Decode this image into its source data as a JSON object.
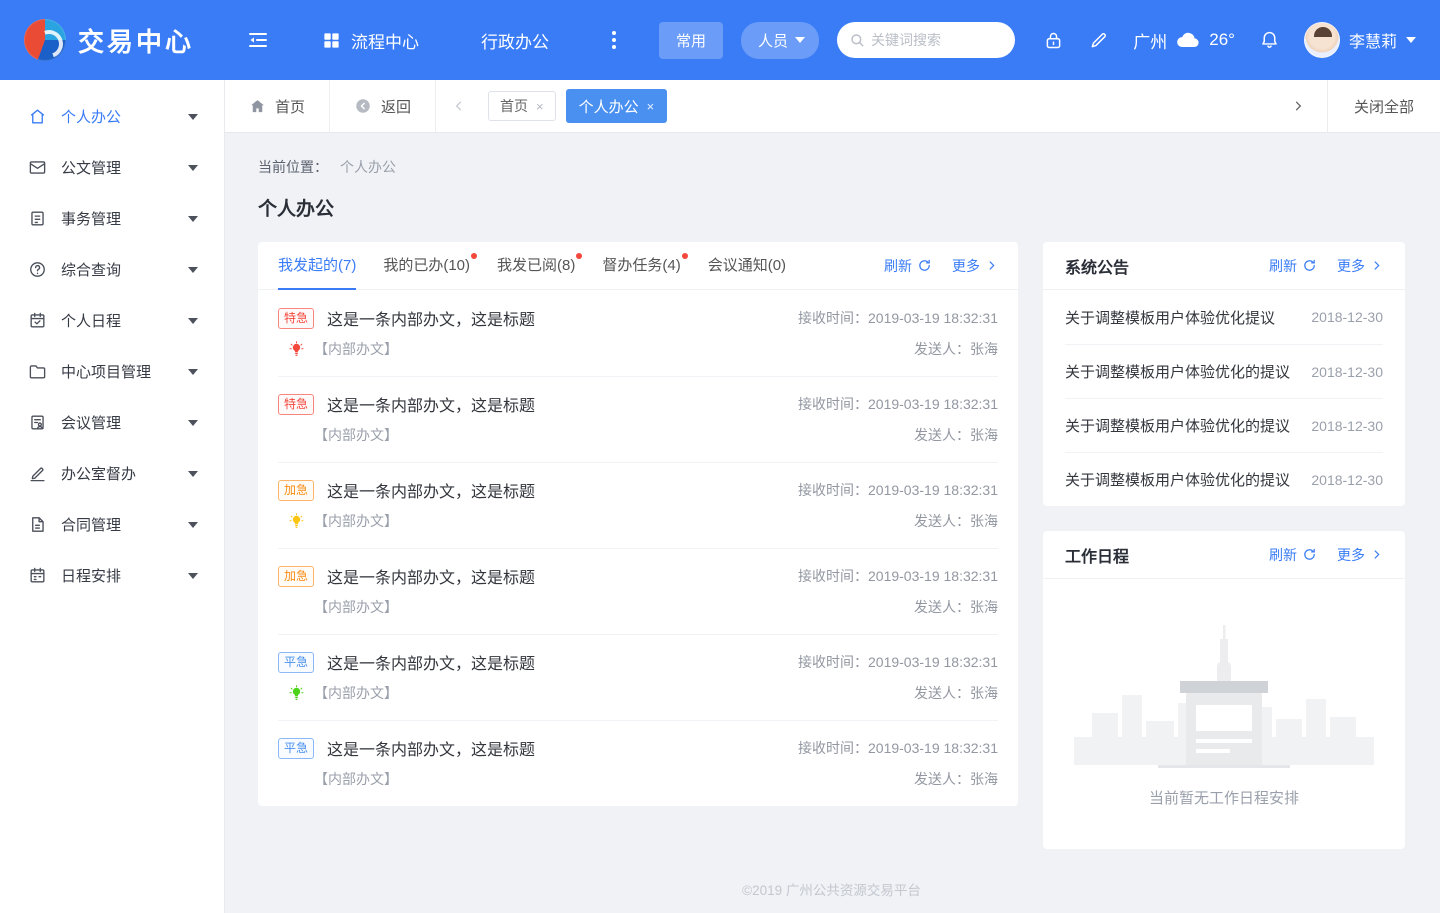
{
  "colors": {
    "primary": "#3a7cf6",
    "chip": "#4a90f0",
    "urgent": "#f5483d",
    "rush": "#fa8c16",
    "normal": "#4a90f0",
    "yellow": "#fbc514",
    "green": "#4cd319"
  },
  "header": {
    "brand": "交易中心",
    "nav": [
      {
        "label": "流程中心"
      },
      {
        "label": "行政办公"
      }
    ],
    "common_button": "常用",
    "people_button": "人员",
    "search_placeholder": "关键词搜索",
    "weather": {
      "city": "广州",
      "temp": "26°"
    },
    "user": {
      "name": "李慧莉"
    }
  },
  "sidebar": {
    "items": [
      {
        "label": "个人办公",
        "active": true
      },
      {
        "label": "公文管理"
      },
      {
        "label": "事务管理"
      },
      {
        "label": "综合查询"
      },
      {
        "label": "个人日程"
      },
      {
        "label": "中心项目管理"
      },
      {
        "label": "会议管理"
      },
      {
        "label": "办公室督办"
      },
      {
        "label": "合同管理"
      },
      {
        "label": "日程安排"
      }
    ]
  },
  "tabbar": {
    "home": "首页",
    "back": "返回",
    "tabs": [
      {
        "label": "首页",
        "active": false,
        "close": "×"
      },
      {
        "label": "个人办公",
        "active": true,
        "close": "×"
      }
    ],
    "close_all": "关闭全部"
  },
  "breadcrumb": {
    "label": "当前位置：",
    "value": "个人办公"
  },
  "page_title": "个人办公",
  "main": {
    "tabs": [
      {
        "label": "我发起的(7)",
        "active": true,
        "dot": false
      },
      {
        "label": "我的已办(10)",
        "dot": true
      },
      {
        "label": "我发已阅(8)",
        "dot": true
      },
      {
        "label": "督办任务(4)",
        "dot": true
      },
      {
        "label": "会议通知(0)",
        "dot": false
      }
    ],
    "refresh_label": "刷新",
    "more_label": "更多",
    "items": [
      {
        "badge": "特急",
        "badge_type": "urgent",
        "bulb": "red",
        "title": "这是一条内部办文，这是标题",
        "category": "【内部办文】",
        "time_label": "接收时间：",
        "time": "2019-03-19 18:32:31",
        "sender_label": "发送人：",
        "sender": "张海"
      },
      {
        "badge": "特急",
        "badge_type": "urgent",
        "bulb": "none",
        "title": "这是一条内部办文，这是标题",
        "category": "【内部办文】",
        "time_label": "接收时间：",
        "time": "2019-03-19 18:32:31",
        "sender_label": "发送人：",
        "sender": "张海"
      },
      {
        "badge": "加急",
        "badge_type": "rush",
        "bulb": "yellow",
        "title": "这是一条内部办文，这是标题",
        "category": "【内部办文】",
        "time_label": "接收时间：",
        "time": "2019-03-19 18:32:31",
        "sender_label": "发送人：",
        "sender": "张海"
      },
      {
        "badge": "加急",
        "badge_type": "rush",
        "bulb": "none",
        "title": "这是一条内部办文，这是标题",
        "category": "【内部办文】",
        "time_label": "接收时间：",
        "time": "2019-03-19 18:32:31",
        "sender_label": "发送人：",
        "sender": "张海"
      },
      {
        "badge": "平急",
        "badge_type": "normal",
        "bulb": "green",
        "title": "这是一条内部办文，这是标题",
        "category": "【内部办文】",
        "time_label": "接收时间：",
        "time": "2019-03-19 18:32:31",
        "sender_label": "发送人：",
        "sender": "张海"
      },
      {
        "badge": "平急",
        "badge_type": "normal",
        "bulb": "none",
        "title": "这是一条内部办文，这是标题",
        "category": "【内部办文】",
        "time_label": "接收时间：",
        "time": "2019-03-19 18:32:31",
        "sender_label": "发送人：",
        "sender": "张海"
      }
    ]
  },
  "announcements": {
    "title": "系统公告",
    "refresh_label": "刷新",
    "more_label": "更多",
    "items": [
      {
        "title": "关于调整模板用户体验优化提议",
        "date": "2018-12-30"
      },
      {
        "title": "关于调整模板用户体验优化的提议",
        "date": "2018-12-30"
      },
      {
        "title": "关于调整模板用户体验优化的提议",
        "date": "2018-12-30"
      },
      {
        "title": "关于调整模板用户体验优化的提议",
        "date": "2018-12-30"
      }
    ]
  },
  "schedule": {
    "title": "工作日程",
    "refresh_label": "刷新",
    "more_label": "更多",
    "empty_text": "当前暂无工作日程安排"
  },
  "footer": "©2019 广州公共资源交易平台"
}
